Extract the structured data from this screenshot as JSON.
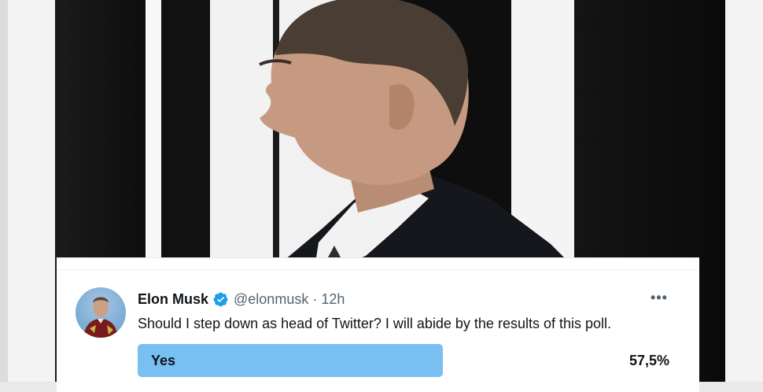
{
  "tweet": {
    "author_name": "Elon Musk",
    "handle": "@elonmusk",
    "separator": "·",
    "time": "12h",
    "more_label": "•••",
    "text": "Should I step down as head of Twitter? I will abide by the results of this poll.",
    "verified_icon": "verified-badge-icon",
    "accent_color": "#1d9bf0"
  },
  "poll": {
    "options": [
      {
        "label": "Yes",
        "percent_label": "57,5%",
        "percent": 57.5,
        "bar_color": "#79c0f2"
      }
    ]
  }
}
